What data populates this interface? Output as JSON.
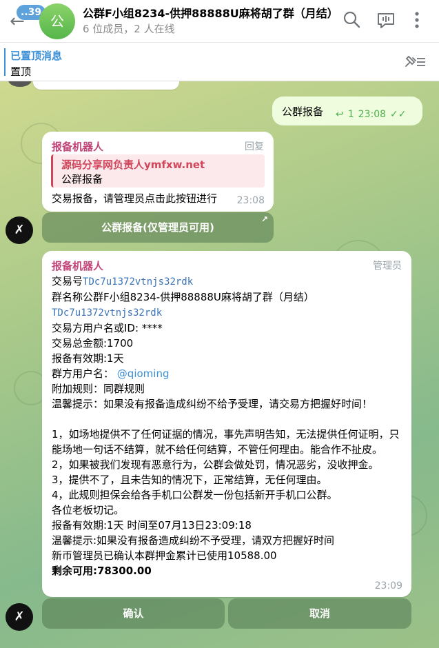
{
  "header": {
    "unread_count": "39",
    "avatar_letter": "公",
    "title": "公群F小组8234-供押88888U麻将胡了群（月结）",
    "subtitle": "6 位成员，2 人在线"
  },
  "pinned": {
    "title": "已置顶消息",
    "text": "置顶"
  },
  "outgoing": {
    "text": "公群报备",
    "reply_count": "1",
    "time": "23:08"
  },
  "msg1": {
    "sender": "报备机器人",
    "action": "回复",
    "reply_title": "源码分享网负责人ymfxw.net",
    "reply_text": "公群报备",
    "text": "交易报备，请管理员点击此按钮进行",
    "time": "23:08",
    "button": "公群报备(仅管理员可用)"
  },
  "msg2": {
    "sender": "报备机器人",
    "role": "管理员",
    "line1_label": "交易号",
    "line1_code": "TDc7u1372vtnjs32rdk",
    "line2": "群名称公群F小组8234-供押88888U麻将胡了群（月结）",
    "line3_code": "TDc7u1372vtnjs32rdk",
    "line4": "交易方用户名或ID: ****",
    "line5": "交易总金额:1700",
    "line6": "报备有效期:1天",
    "line7_label": "群方用户名：",
    "line7_link": "@qioming",
    "line8": "附加规则：同群规则",
    "line9": "温馨提示：如果没有报备造成纠纷不给予受理，请交易方把握好时间！",
    "rule1": "1，如场地提供不了任何证据的情况，事先声明告知，无法提供任何证明，只能场地一句话不结算，就不给任何结算，不管任何理由。能合作不扯皮。",
    "rule2": "2，如果被我们发现有恶意行为，公群会做处罚，情况恶劣，没收押金。",
    "rule3": "3，提供不了，且未告知的情况下，正常结算，无任何理由。",
    "rule4": "4，此规则担保会给各手机口公群发一份包括新开手机口公群。",
    "line_each": "各位老板切记。",
    "validity": "报备有效期:1天  时间至07月13日23:09:18",
    "tip2": "温馨提示:如果没有报备造成纠纷不予受理，请双方把握好时间",
    "confirm_text": "新币管理员已确认本群押金累计已使用10588.00",
    "remaining": "剩余可用:78300.00",
    "time": "23:09",
    "btn_confirm": "确认",
    "btn_cancel": "取消"
  },
  "colors": {
    "accent": "#3a8fd6",
    "sender": "#c2457a",
    "reply_accent": "#d1465a",
    "outgoing_bg": "#effdde"
  },
  "icons": {
    "back": "arrow-left-icon",
    "search": "search-icon",
    "voice_chat": "voice-chat-icon",
    "menu": "more-vertical-icon",
    "pin": "pin-list-icon"
  }
}
